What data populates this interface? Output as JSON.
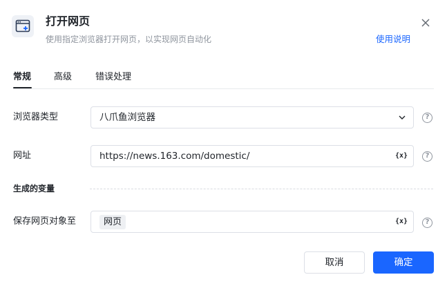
{
  "header": {
    "icon": "browser-window-add-icon",
    "title": "打开网页",
    "subtitle": "使用指定浏览器打开网页，以实现网页自动化",
    "help_link": "使用说明",
    "close_icon": "close-icon"
  },
  "tabs": [
    {
      "label": "常规",
      "active": true
    },
    {
      "label": "高级",
      "active": false
    },
    {
      "label": "错误处理",
      "active": false
    }
  ],
  "fields": {
    "browser_type": {
      "label": "浏览器类型",
      "value": "八爪鱼浏览器"
    },
    "url": {
      "label": "网址",
      "value": "https://news.163.com/domestic/",
      "var_icon": "{x}"
    },
    "section_title": "生成的变量",
    "save_to": {
      "label": "保存网页对象至",
      "value": "网页",
      "var_icon": "{x}"
    }
  },
  "help_icon": "?",
  "buttons": {
    "cancel": "取消",
    "ok": "确定"
  },
  "colors": {
    "accent": "#1a66ff",
    "text": "#1f2329",
    "muted": "#8f959e",
    "border": "#dcdfe6"
  }
}
